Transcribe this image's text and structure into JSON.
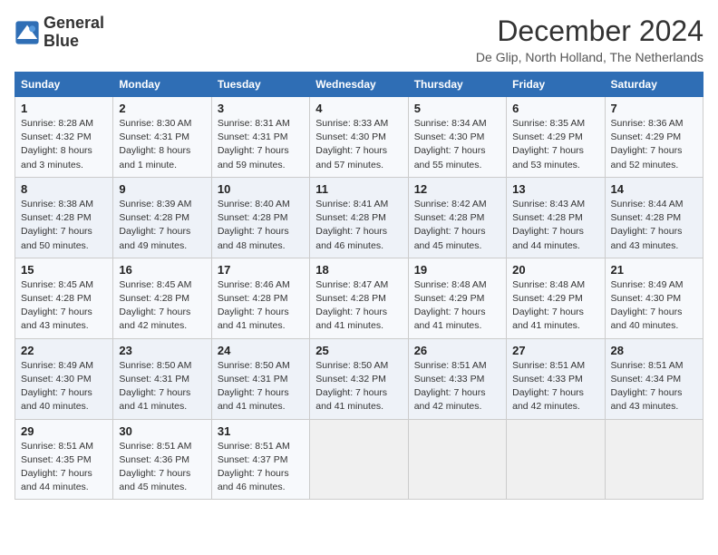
{
  "logo": {
    "line1": "General",
    "line2": "Blue"
  },
  "title": "December 2024",
  "subtitle": "De Glip, North Holland, The Netherlands",
  "weekdays": [
    "Sunday",
    "Monday",
    "Tuesday",
    "Wednesday",
    "Thursday",
    "Friday",
    "Saturday"
  ],
  "weeks": [
    [
      {
        "day": "1",
        "sunrise": "Sunrise: 8:28 AM",
        "sunset": "Sunset: 4:32 PM",
        "daylight": "Daylight: 8 hours and 3 minutes."
      },
      {
        "day": "2",
        "sunrise": "Sunrise: 8:30 AM",
        "sunset": "Sunset: 4:31 PM",
        "daylight": "Daylight: 8 hours and 1 minute."
      },
      {
        "day": "3",
        "sunrise": "Sunrise: 8:31 AM",
        "sunset": "Sunset: 4:31 PM",
        "daylight": "Daylight: 7 hours and 59 minutes."
      },
      {
        "day": "4",
        "sunrise": "Sunrise: 8:33 AM",
        "sunset": "Sunset: 4:30 PM",
        "daylight": "Daylight: 7 hours and 57 minutes."
      },
      {
        "day": "5",
        "sunrise": "Sunrise: 8:34 AM",
        "sunset": "Sunset: 4:30 PM",
        "daylight": "Daylight: 7 hours and 55 minutes."
      },
      {
        "day": "6",
        "sunrise": "Sunrise: 8:35 AM",
        "sunset": "Sunset: 4:29 PM",
        "daylight": "Daylight: 7 hours and 53 minutes."
      },
      {
        "day": "7",
        "sunrise": "Sunrise: 8:36 AM",
        "sunset": "Sunset: 4:29 PM",
        "daylight": "Daylight: 7 hours and 52 minutes."
      }
    ],
    [
      {
        "day": "8",
        "sunrise": "Sunrise: 8:38 AM",
        "sunset": "Sunset: 4:28 PM",
        "daylight": "Daylight: 7 hours and 50 minutes."
      },
      {
        "day": "9",
        "sunrise": "Sunrise: 8:39 AM",
        "sunset": "Sunset: 4:28 PM",
        "daylight": "Daylight: 7 hours and 49 minutes."
      },
      {
        "day": "10",
        "sunrise": "Sunrise: 8:40 AM",
        "sunset": "Sunset: 4:28 PM",
        "daylight": "Daylight: 7 hours and 48 minutes."
      },
      {
        "day": "11",
        "sunrise": "Sunrise: 8:41 AM",
        "sunset": "Sunset: 4:28 PM",
        "daylight": "Daylight: 7 hours and 46 minutes."
      },
      {
        "day": "12",
        "sunrise": "Sunrise: 8:42 AM",
        "sunset": "Sunset: 4:28 PM",
        "daylight": "Daylight: 7 hours and 45 minutes."
      },
      {
        "day": "13",
        "sunrise": "Sunrise: 8:43 AM",
        "sunset": "Sunset: 4:28 PM",
        "daylight": "Daylight: 7 hours and 44 minutes."
      },
      {
        "day": "14",
        "sunrise": "Sunrise: 8:44 AM",
        "sunset": "Sunset: 4:28 PM",
        "daylight": "Daylight: 7 hours and 43 minutes."
      }
    ],
    [
      {
        "day": "15",
        "sunrise": "Sunrise: 8:45 AM",
        "sunset": "Sunset: 4:28 PM",
        "daylight": "Daylight: 7 hours and 43 minutes."
      },
      {
        "day": "16",
        "sunrise": "Sunrise: 8:45 AM",
        "sunset": "Sunset: 4:28 PM",
        "daylight": "Daylight: 7 hours and 42 minutes."
      },
      {
        "day": "17",
        "sunrise": "Sunrise: 8:46 AM",
        "sunset": "Sunset: 4:28 PM",
        "daylight": "Daylight: 7 hours and 41 minutes."
      },
      {
        "day": "18",
        "sunrise": "Sunrise: 8:47 AM",
        "sunset": "Sunset: 4:28 PM",
        "daylight": "Daylight: 7 hours and 41 minutes."
      },
      {
        "day": "19",
        "sunrise": "Sunrise: 8:48 AM",
        "sunset": "Sunset: 4:29 PM",
        "daylight": "Daylight: 7 hours and 41 minutes."
      },
      {
        "day": "20",
        "sunrise": "Sunrise: 8:48 AM",
        "sunset": "Sunset: 4:29 PM",
        "daylight": "Daylight: 7 hours and 41 minutes."
      },
      {
        "day": "21",
        "sunrise": "Sunrise: 8:49 AM",
        "sunset": "Sunset: 4:30 PM",
        "daylight": "Daylight: 7 hours and 40 minutes."
      }
    ],
    [
      {
        "day": "22",
        "sunrise": "Sunrise: 8:49 AM",
        "sunset": "Sunset: 4:30 PM",
        "daylight": "Daylight: 7 hours and 40 minutes."
      },
      {
        "day": "23",
        "sunrise": "Sunrise: 8:50 AM",
        "sunset": "Sunset: 4:31 PM",
        "daylight": "Daylight: 7 hours and 41 minutes."
      },
      {
        "day": "24",
        "sunrise": "Sunrise: 8:50 AM",
        "sunset": "Sunset: 4:31 PM",
        "daylight": "Daylight: 7 hours and 41 minutes."
      },
      {
        "day": "25",
        "sunrise": "Sunrise: 8:50 AM",
        "sunset": "Sunset: 4:32 PM",
        "daylight": "Daylight: 7 hours and 41 minutes."
      },
      {
        "day": "26",
        "sunrise": "Sunrise: 8:51 AM",
        "sunset": "Sunset: 4:33 PM",
        "daylight": "Daylight: 7 hours and 42 minutes."
      },
      {
        "day": "27",
        "sunrise": "Sunrise: 8:51 AM",
        "sunset": "Sunset: 4:33 PM",
        "daylight": "Daylight: 7 hours and 42 minutes."
      },
      {
        "day": "28",
        "sunrise": "Sunrise: 8:51 AM",
        "sunset": "Sunset: 4:34 PM",
        "daylight": "Daylight: 7 hours and 43 minutes."
      }
    ],
    [
      {
        "day": "29",
        "sunrise": "Sunrise: 8:51 AM",
        "sunset": "Sunset: 4:35 PM",
        "daylight": "Daylight: 7 hours and 44 minutes."
      },
      {
        "day": "30",
        "sunrise": "Sunrise: 8:51 AM",
        "sunset": "Sunset: 4:36 PM",
        "daylight": "Daylight: 7 hours and 45 minutes."
      },
      {
        "day": "31",
        "sunrise": "Sunrise: 8:51 AM",
        "sunset": "Sunset: 4:37 PM",
        "daylight": "Daylight: 7 hours and 46 minutes."
      },
      null,
      null,
      null,
      null
    ]
  ]
}
